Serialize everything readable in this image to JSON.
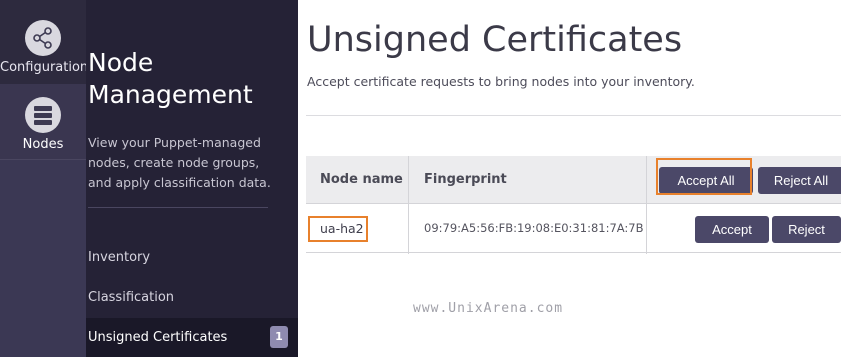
{
  "rail": {
    "items": [
      {
        "label": "Configuration",
        "icon": "share-icon"
      },
      {
        "label": "Nodes",
        "icon": "server-stack-icon"
      }
    ]
  },
  "sidebar": {
    "title_line1": "Node",
    "title_line2": "Management",
    "description": "View your Puppet-managed nodes, create node groups, and apply classification data.",
    "links": [
      {
        "label": "Inventory"
      },
      {
        "label": "Classification"
      },
      {
        "label": "Unsigned Certificates",
        "badge": "1",
        "active": true
      }
    ]
  },
  "main": {
    "title": "Unsigned Certificates",
    "subtitle": "Accept certificate requests to bring nodes into your inventory.",
    "table": {
      "columns": [
        "Node name",
        "Fingerprint"
      ],
      "accept_all_label": "Accept All",
      "reject_all_label": "Reject All",
      "rows": [
        {
          "node_name": "ua-ha2",
          "fingerprint": "09:79:A5:56:FB:19:08:E0:31:81:7A:7B",
          "accept_label": "Accept",
          "reject_label": "Reject"
        }
      ]
    }
  },
  "watermark": "www.UnixArena.com",
  "colors": {
    "rail_bg": "#2d2a3e",
    "sidebar_bg": "#252236",
    "button_bg": "#4b4868",
    "highlight": "#e8812c",
    "badge_bg": "#8f8bb0"
  }
}
